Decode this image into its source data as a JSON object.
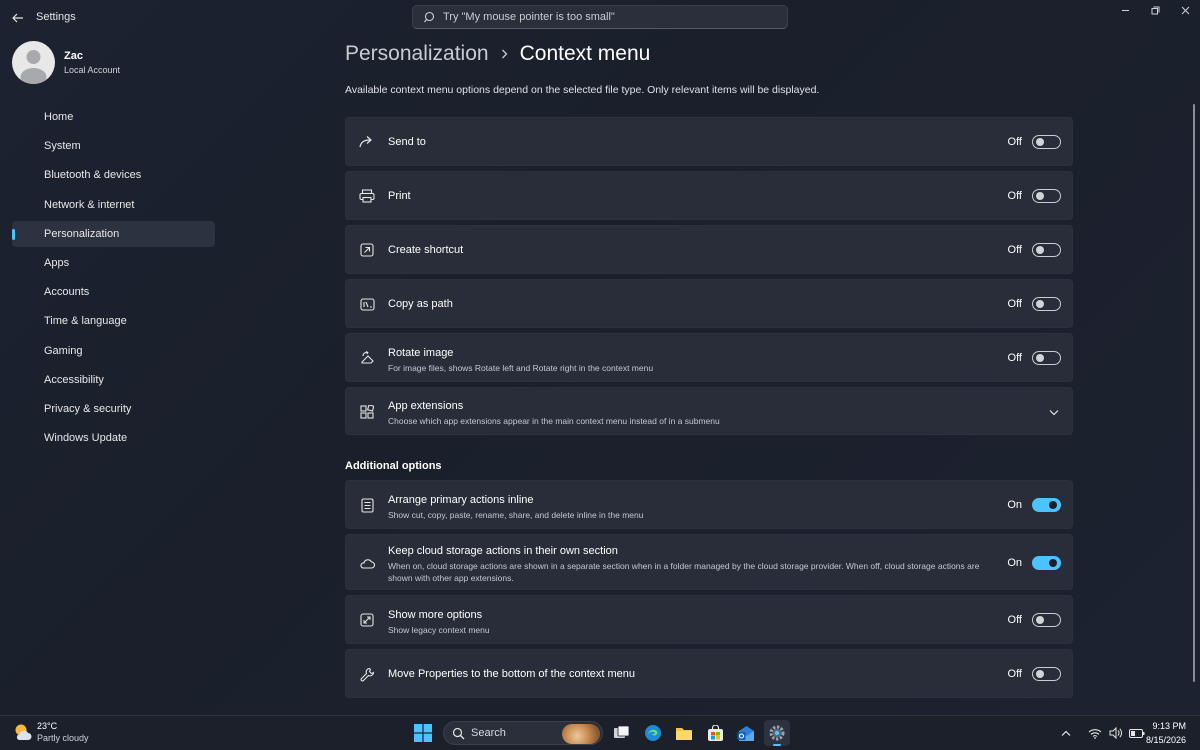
{
  "window": {
    "title": "Settings",
    "search_placeholder": "Try \"My mouse pointer is too small\""
  },
  "profile": {
    "name": "Zac",
    "account_type": "Local Account"
  },
  "nav": {
    "items": [
      {
        "label": "Home"
      },
      {
        "label": "System"
      },
      {
        "label": "Bluetooth & devices"
      },
      {
        "label": "Network & internet"
      },
      {
        "label": "Personalization",
        "active": true
      },
      {
        "label": "Apps"
      },
      {
        "label": "Accounts"
      },
      {
        "label": "Time & language"
      },
      {
        "label": "Gaming"
      },
      {
        "label": "Accessibility"
      },
      {
        "label": "Privacy & security"
      },
      {
        "label": "Windows Update"
      }
    ]
  },
  "page": {
    "breadcrumb_parent": "Personalization",
    "title": "Context menu",
    "description": "Available context menu options depend on the selected file type. Only relevant items will be displayed.",
    "section_title": "Additional options"
  },
  "settings": [
    {
      "title": "Send to",
      "state": "Off",
      "icon": "share-arrow-icon"
    },
    {
      "title": "Print",
      "state": "Off",
      "icon": "printer-icon"
    },
    {
      "title": "Create shortcut",
      "state": "Off",
      "icon": "shortcut-icon"
    },
    {
      "title": "Copy as path",
      "state": "Off",
      "icon": "copy-path-icon"
    },
    {
      "title": "Rotate image",
      "subtitle": "For image files, shows Rotate left and Rotate right in the context menu",
      "state": "Off",
      "icon": "rotate-image-icon"
    },
    {
      "title": "App extensions",
      "subtitle": "Choose which app extensions appear in the main context menu instead of in a submenu",
      "icon": "apps-grid-icon"
    }
  ],
  "additional": [
    {
      "title": "Arrange primary actions inline",
      "subtitle": "Show cut, copy, paste, rename, share, and delete inline in the menu",
      "state": "On",
      "icon": "list-icon"
    },
    {
      "title": "Keep cloud storage actions in their own section",
      "subtitle": "When on, cloud storage actions are shown in a separate section when in a folder managed by the cloud storage provider. When off, cloud storage actions are shown with other app extensions.",
      "state": "On",
      "icon": "cloud-icon"
    },
    {
      "title": "Show more options",
      "subtitle": "Show legacy context menu",
      "state": "Off",
      "icon": "expand-icon"
    },
    {
      "title": "Move Properties to the bottom of the context menu",
      "state": "Off",
      "icon": "wrench-icon"
    }
  ],
  "taskbar": {
    "weather_temp": "23°C",
    "weather_desc": "Partly cloudy",
    "search_label": "Search",
    "time": "9:13 PM",
    "date": "8/15/2026"
  },
  "colors": {
    "accent": "#4cc2ff",
    "card": "#282d39",
    "background": "#1c2230"
  }
}
